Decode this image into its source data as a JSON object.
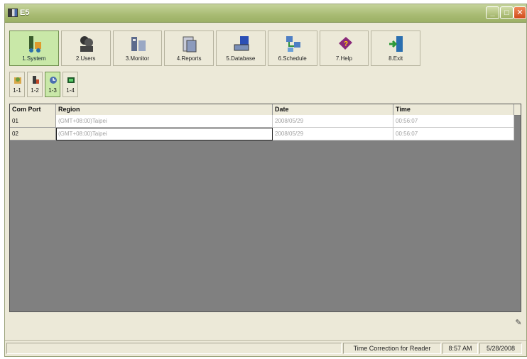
{
  "window": {
    "title": "E5"
  },
  "toolbar": {
    "items": [
      {
        "label": "1.System"
      },
      {
        "label": "2.Users"
      },
      {
        "label": "3.Monitor"
      },
      {
        "label": "4.Reports"
      },
      {
        "label": "5.Database"
      },
      {
        "label": "6.Schedule"
      },
      {
        "label": "7.Help"
      },
      {
        "label": "8.Exit"
      }
    ]
  },
  "subtoolbar": {
    "items": [
      {
        "label": "1-1"
      },
      {
        "label": "1-2"
      },
      {
        "label": "1-3"
      },
      {
        "label": "1-4"
      }
    ]
  },
  "grid": {
    "columns": [
      "Com Port",
      "Region",
      "Date",
      "Time"
    ],
    "rows": [
      {
        "port": "01",
        "region": "(GMT+08:00)Taipei",
        "date": "2008/05/29",
        "time": "00:56:07"
      },
      {
        "port": "02",
        "region": "(GMT+08:00)Taipei",
        "date": "2008/05/29",
        "time": "00:56:07"
      }
    ]
  },
  "status": {
    "message": "Time Correction for Reader",
    "time": "8:57 AM",
    "date": "5/28/2008"
  },
  "colors": {
    "titlebar": "#a8bb73",
    "active_tab": "#c9e8a8",
    "grid_background": "#808080"
  }
}
